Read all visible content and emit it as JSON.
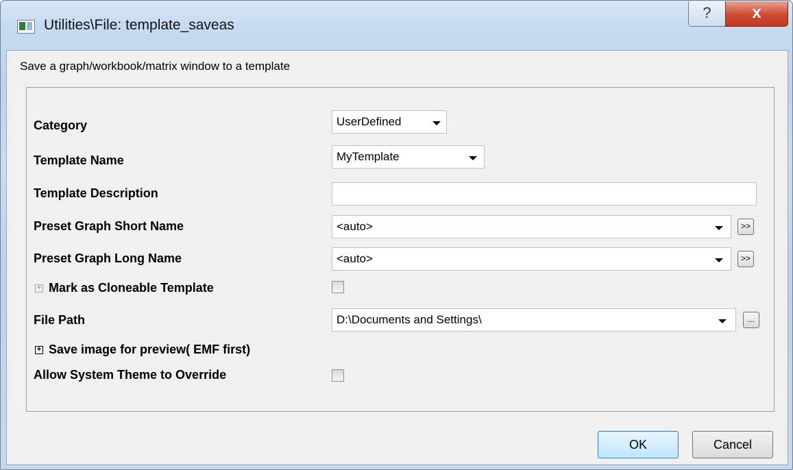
{
  "window": {
    "title": "Utilities\\File: template_saveas",
    "help_label": "?",
    "close_label": "x"
  },
  "description": "Save a graph/workbook/matrix window to a template",
  "fields": {
    "category": {
      "label": "Category",
      "value": "UserDefined"
    },
    "template_name": {
      "label": "Template Name",
      "value": "MyTemplate"
    },
    "template_description": {
      "label": "Template Description",
      "value": ""
    },
    "preset_short_name": {
      "label": "Preset Graph Short Name",
      "value": "<auto>",
      "button_label": ">>"
    },
    "preset_long_name": {
      "label": "Preset Graph Long Name",
      "value": "<auto>",
      "button_label": ">>"
    },
    "mark_cloneable": {
      "label": "Mark as Cloneable Template",
      "checked": false
    },
    "file_path": {
      "label": "File Path",
      "value": "D:\\Documents and Settings\\",
      "button_label": "..."
    },
    "save_image": {
      "label": "Save image for preview( EMF first)"
    },
    "allow_theme": {
      "label": "Allow System Theme to Override",
      "checked": false
    }
  },
  "buttons": {
    "ok": "OK",
    "cancel": "Cancel"
  },
  "icons": {
    "app": "window-app-icon",
    "help": "help-icon",
    "close": "close-icon",
    "expand": "plus-expander-icon"
  },
  "colors": {
    "ok_border": "#3c7fb1",
    "close_red": "#cf4a30"
  }
}
